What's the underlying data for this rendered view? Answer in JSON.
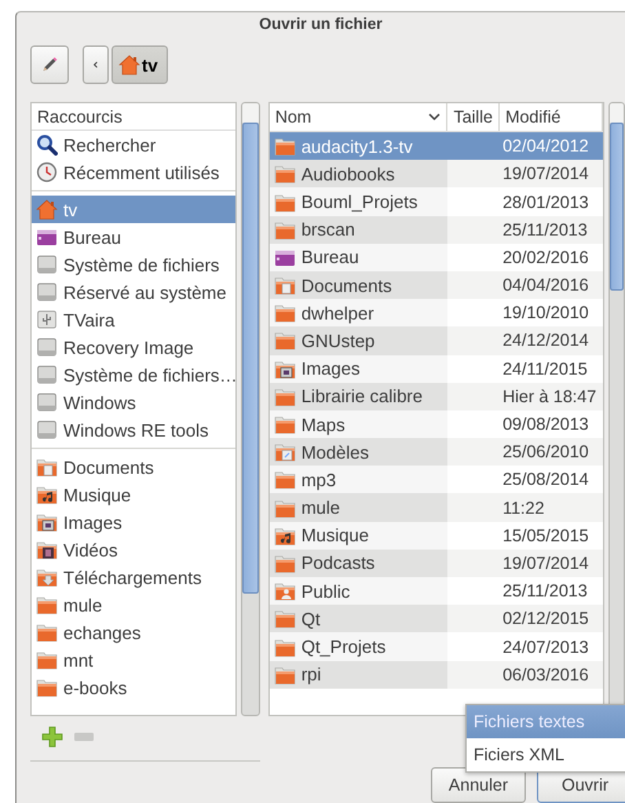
{
  "window": {
    "title": "Ouvrir un fichier"
  },
  "toolbar": {
    "path": [
      {
        "label": "tv",
        "kind": "home",
        "selected": true
      }
    ]
  },
  "sidebar": {
    "header": "Raccourcis",
    "groups": [
      [
        {
          "label": "Rechercher",
          "kind": "search",
          "selected": false
        },
        {
          "label": "Récemment utilisés",
          "kind": "recent",
          "selected": false
        }
      ],
      [
        {
          "label": "tv",
          "kind": "home",
          "selected": true
        },
        {
          "label": "Bureau",
          "kind": "desktop",
          "selected": false
        },
        {
          "label": "Système de fichiers",
          "kind": "drive",
          "selected": false
        },
        {
          "label": "Réservé au système",
          "kind": "drive",
          "selected": false
        },
        {
          "label": "TVaira",
          "kind": "usb",
          "selected": false
        },
        {
          "label": "Recovery Image",
          "kind": "drive",
          "selected": false
        },
        {
          "label": "Système de fichiers…",
          "kind": "drive",
          "selected": false
        },
        {
          "label": "Windows",
          "kind": "drive",
          "selected": false
        },
        {
          "label": "Windows RE tools",
          "kind": "drive",
          "selected": false
        }
      ],
      [
        {
          "label": "Documents",
          "kind": "documents",
          "selected": false
        },
        {
          "label": "Musique",
          "kind": "music",
          "selected": false
        },
        {
          "label": "Images",
          "kind": "images",
          "selected": false
        },
        {
          "label": "Vidéos",
          "kind": "videos",
          "selected": false
        },
        {
          "label": "Téléchargements",
          "kind": "downloads",
          "selected": false
        },
        {
          "label": "mule",
          "kind": "folder",
          "selected": false
        },
        {
          "label": "echanges",
          "kind": "folder",
          "selected": false
        },
        {
          "label": "mnt",
          "kind": "folder",
          "selected": false
        },
        {
          "label": "e-books",
          "kind": "folder",
          "selected": false
        }
      ]
    ]
  },
  "table": {
    "columns": [
      "Nom",
      "Taille",
      "Modifié"
    ],
    "rows": [
      {
        "name": "audacity1.3-tv",
        "kind": "folder",
        "modified": "02/04/2012",
        "selected": true
      },
      {
        "name": "Audiobooks",
        "kind": "folder",
        "modified": "19/07/2014",
        "selected": false
      },
      {
        "name": "Bouml_Projets",
        "kind": "folder",
        "modified": "28/01/2013",
        "selected": false
      },
      {
        "name": "brscan",
        "kind": "folder",
        "modified": "25/11/2013",
        "selected": false
      },
      {
        "name": "Bureau",
        "kind": "desktop",
        "modified": "20/02/2016",
        "selected": false
      },
      {
        "name": "Documents",
        "kind": "documents",
        "modified": "04/04/2016",
        "selected": false
      },
      {
        "name": "dwhelper",
        "kind": "folder",
        "modified": "19/10/2010",
        "selected": false
      },
      {
        "name": "GNUstep",
        "kind": "folder",
        "modified": "24/12/2014",
        "selected": false
      },
      {
        "name": "Images",
        "kind": "images",
        "modified": "24/11/2015",
        "selected": false
      },
      {
        "name": "Librairie calibre",
        "kind": "folder",
        "modified": "Hier à 18:47",
        "selected": false
      },
      {
        "name": "Maps",
        "kind": "folder",
        "modified": "09/08/2013",
        "selected": false
      },
      {
        "name": "Modèles",
        "kind": "templates",
        "modified": "25/06/2010",
        "selected": false
      },
      {
        "name": "mp3",
        "kind": "folder",
        "modified": "25/08/2014",
        "selected": false
      },
      {
        "name": "mule",
        "kind": "folder",
        "modified": "11:22",
        "selected": false
      },
      {
        "name": "Musique",
        "kind": "music",
        "modified": "15/05/2015",
        "selected": false
      },
      {
        "name": "Podcasts",
        "kind": "folder",
        "modified": "19/07/2014",
        "selected": false
      },
      {
        "name": "Public",
        "kind": "public",
        "modified": "25/11/2013",
        "selected": false
      },
      {
        "name": "Qt",
        "kind": "folder",
        "modified": "02/12/2015",
        "selected": false
      },
      {
        "name": "Qt_Projets",
        "kind": "folder",
        "modified": "24/07/2013",
        "selected": false
      },
      {
        "name": "rpi",
        "kind": "folder",
        "modified": "06/03/2016",
        "selected": false
      }
    ]
  },
  "filter_menu": [
    {
      "label": "Fichiers textes",
      "selected": true
    },
    {
      "label": "Ficiers XML",
      "selected": false
    }
  ],
  "buttons": [
    "Annuler",
    "Ouvrir"
  ]
}
